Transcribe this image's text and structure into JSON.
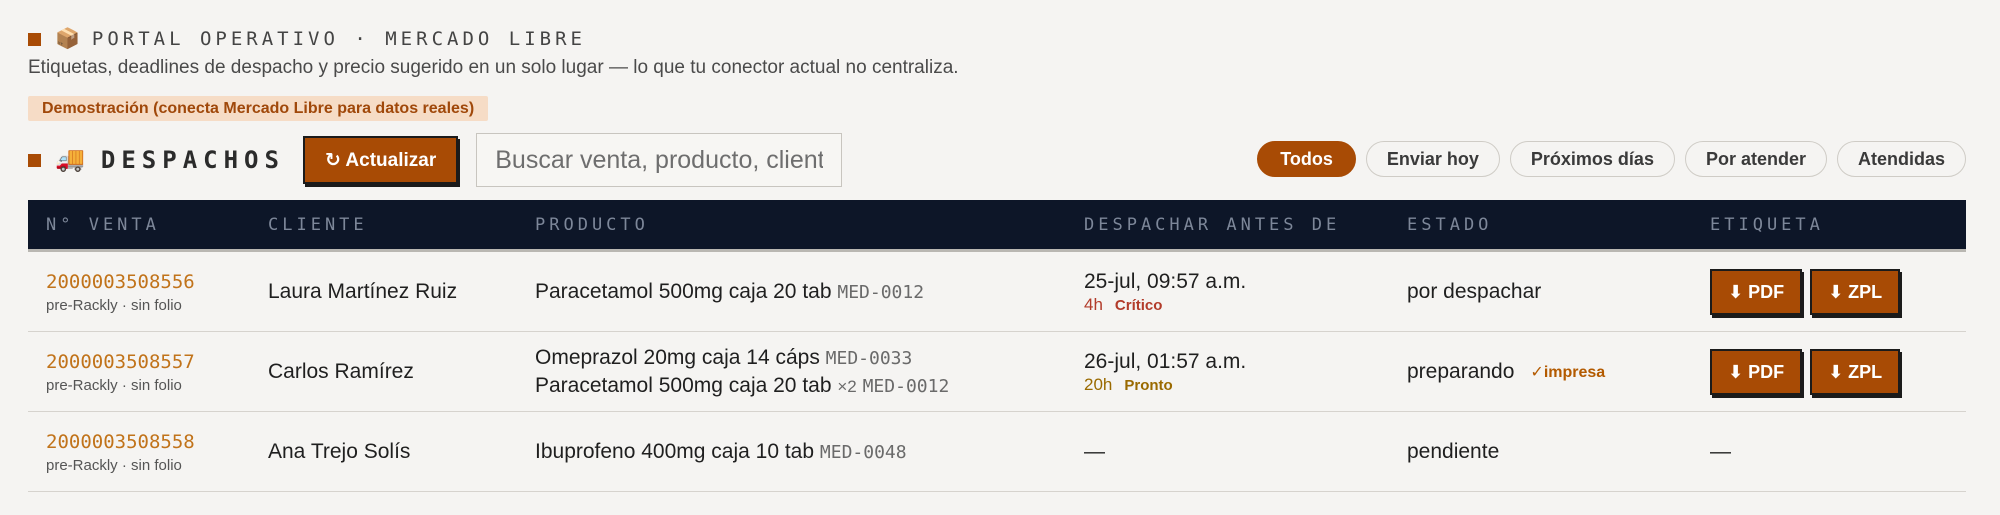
{
  "header": {
    "portal_icon": "📦",
    "portal_title": "PORTAL OPERATIVO · MERCADO LIBRE",
    "subtitle": "Etiquetas, deadlines de despacho y precio sugerido en un solo lugar — lo que tu conector actual no centraliza.",
    "demo_badge": "Demostración (conecta Mercado Libre para datos reales)"
  },
  "despachos": {
    "icon": "🚚",
    "title": "DESPACHOS",
    "refresh_label": "↻ Actualizar",
    "search_placeholder": "Buscar venta, producto, cliente",
    "filters": [
      {
        "label": "Todos",
        "active": true
      },
      {
        "label": "Enviar hoy",
        "active": false
      },
      {
        "label": "Próximos días",
        "active": false
      },
      {
        "label": "Por atender",
        "active": false
      },
      {
        "label": "Atendidas",
        "active": false
      }
    ]
  },
  "table": {
    "columns": [
      "N° VENTA",
      "CLIENTE",
      "PRODUCTO",
      "DESPACHAR ANTES DE",
      "ESTADO",
      "ETIQUETA"
    ],
    "rows": [
      {
        "order_id": "2000003508556",
        "order_sub": "pre-Rackly · sin folio",
        "client": "Laura Martínez Ruiz",
        "products": [
          {
            "name": "Paracetamol 500mg caja 20 tab",
            "qty": "",
            "sku": "MED-0012"
          }
        ],
        "deadline": "25-jul, 09:57 a.m.",
        "hours": "4h",
        "urgency": "Crítico",
        "estado": "por despachar",
        "impresa": "",
        "pdf_label": "⬇ PDF",
        "zpl_label": "⬇ ZPL"
      },
      {
        "order_id": "2000003508557",
        "order_sub": "pre-Rackly · sin folio",
        "client": "Carlos Ramírez",
        "products": [
          {
            "name": "Omeprazol 20mg caja 14 cáps",
            "qty": "",
            "sku": "MED-0033"
          },
          {
            "name": "Paracetamol 500mg caja 20 tab",
            "qty": "×2",
            "sku": "MED-0012"
          }
        ],
        "deadline": "26-jul, 01:57 a.m.",
        "hours": "20h",
        "urgency": "Pronto",
        "estado": "preparando",
        "impresa": "✓impresa",
        "pdf_label": "⬇ PDF",
        "zpl_label": "⬇ ZPL"
      },
      {
        "order_id": "2000003508558",
        "order_sub": "pre-Rackly · sin folio",
        "client": "Ana Trejo Solís",
        "products": [
          {
            "name": "Ibuprofeno 400mg caja 10 tab",
            "qty": "",
            "sku": "MED-0048"
          }
        ],
        "deadline_dash": "—",
        "estado": "pendiente",
        "label_dash": "—"
      }
    ]
  },
  "colors": {
    "accent": "#a84b05",
    "header_bg": "#0d1628",
    "critical": "#b23b2a",
    "soon": "#9a6a00",
    "order_link": "#c1731a"
  }
}
